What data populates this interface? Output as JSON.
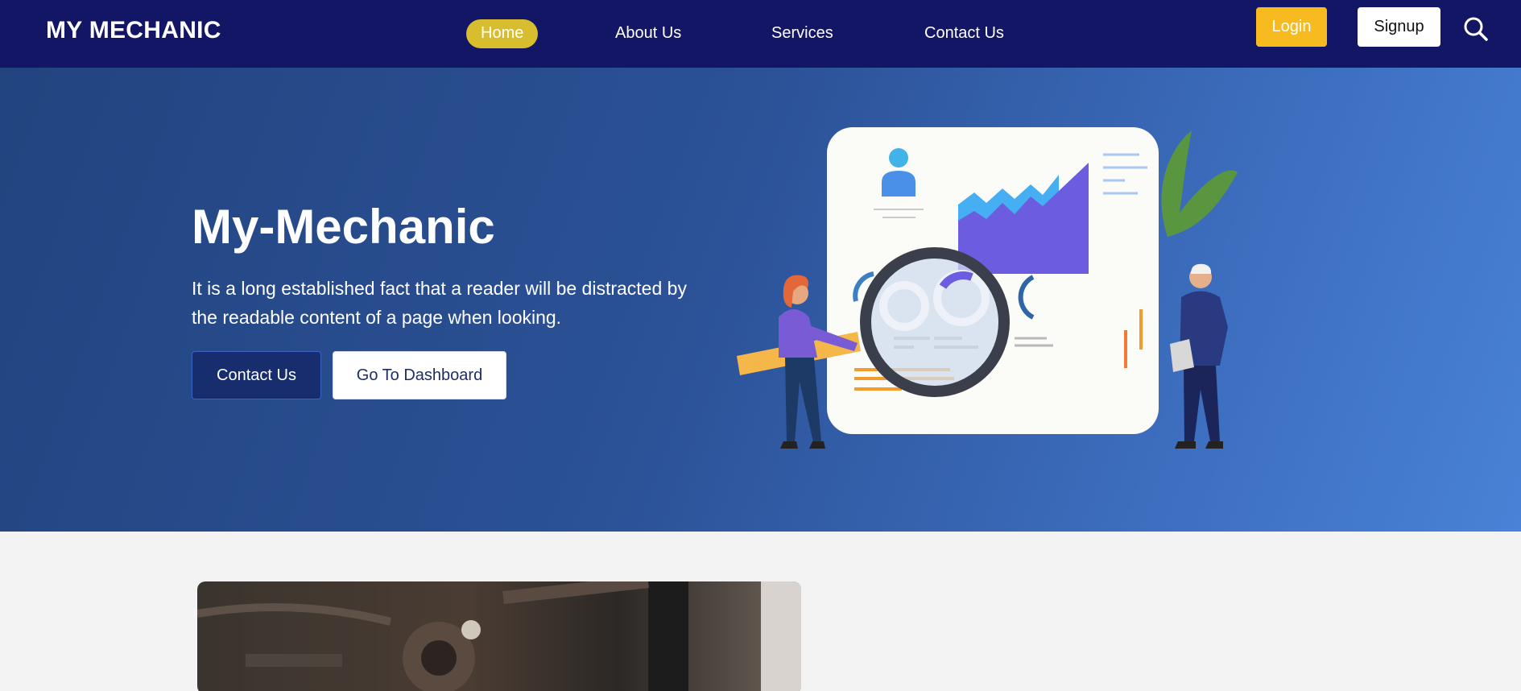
{
  "navbar": {
    "brand": "MY MECHANIC",
    "links": [
      {
        "label": "Home",
        "active": true
      },
      {
        "label": "About Us",
        "active": false
      },
      {
        "label": "Services",
        "active": false
      },
      {
        "label": "Contact Us",
        "active": false
      }
    ],
    "login_label": "Login",
    "signup_label": "Signup",
    "search_icon": "search-icon"
  },
  "hero": {
    "title": "My-Mechanic",
    "text": "It is a long established fact that a reader will be distracted by the readable content of a page when looking.",
    "contact_label": "Contact Us",
    "dashboard_label": "Go To Dashboard",
    "illustration": "data-analysis-illustration"
  },
  "about": {
    "image": "mechanic-under-car-photo"
  },
  "colors": {
    "navbar_bg": "#131664",
    "active_pill": "#d8bd2e",
    "login_bg": "#f7bb1f",
    "hero_gradient_start": "#22447f",
    "hero_gradient_end": "#4982d6",
    "contact_button_bg": "#172d6e",
    "page_bg": "#f3f3f3"
  }
}
